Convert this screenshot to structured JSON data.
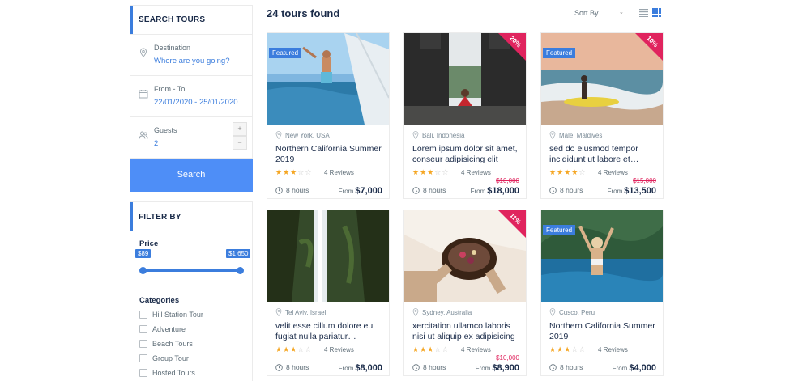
{
  "search": {
    "title": "SEARCH TOURS",
    "destination_label": "Destination",
    "destination_value": "Where are you going?",
    "dates_label": "From - To",
    "dates_value": "22/01/2020 - 25/01/2020",
    "guests_label": "Guests",
    "guests_value": "2",
    "plus": "+",
    "minus": "−",
    "button": "Search"
  },
  "filter": {
    "title": "FILTER BY",
    "price_heading": "Price",
    "price_min": "$89",
    "price_max": "$1 650",
    "price_range_low": 0.0,
    "price_range_high": 1.0,
    "categories_heading": "Categories",
    "categories": [
      "Hill Station Tour",
      "Adventure",
      "Beach Tours",
      "Group Tour",
      "Hosted Tours"
    ]
  },
  "header": {
    "results": "24 tours found",
    "sort_label": "Sort By",
    "sort_chevron": "⌄"
  },
  "labels": {
    "featured": "Featured",
    "reviews": "4 Reviews",
    "from": "From"
  },
  "colors": {
    "accent": "#3b7ddd",
    "button": "#4e8ef7",
    "discount": "#e0245e",
    "star": "#f5a623"
  },
  "tours": [
    {
      "location": "New York, USA",
      "title": "Northern California Summer 2019",
      "rating": 2.5,
      "reviews": "4 Reviews",
      "duration": "8 hours",
      "price": "$7,000",
      "old_price": "",
      "badge": "Featured",
      "discount": ""
    },
    {
      "location": "Bali, Indonesia",
      "title": "Lorem ipsum dolor sit amet, conseur adipisicing elit",
      "rating": 2.5,
      "reviews": "4 Reviews",
      "duration": "8 hours",
      "price": "$18,000",
      "old_price": "$10,000",
      "badge": "",
      "discount": "20%"
    },
    {
      "location": "Male, Maldives",
      "title": "sed do eiusmod tempor incididunt ut labore et…",
      "rating": 3.5,
      "reviews": "4 Reviews",
      "duration": "8 hours",
      "price": "$13,500",
      "old_price": "$15,000",
      "badge": "Featured",
      "discount": "10%"
    },
    {
      "location": "Tel Aviv, Israel",
      "title": "velit esse cillum dolore eu fugiat nulla pariatur…",
      "rating": 2.5,
      "reviews": "4 Reviews",
      "duration": "8 hours",
      "price": "$8,000",
      "old_price": "",
      "badge": "",
      "discount": ""
    },
    {
      "location": "Sydney, Australia",
      "title": "xercitation ullamco laboris nisi ut aliquip ex adipisicing",
      "rating": 2.5,
      "reviews": "4 Reviews",
      "duration": "8 hours",
      "price": "$8,900",
      "old_price": "$10,000",
      "badge": "",
      "discount": "11%"
    },
    {
      "location": "Cusco, Peru",
      "title": "Northern California Summer 2019",
      "rating": 2.5,
      "reviews": "4 Reviews",
      "duration": "8 hours",
      "price": "$4,000",
      "old_price": "",
      "badge": "Featured",
      "discount": ""
    }
  ]
}
